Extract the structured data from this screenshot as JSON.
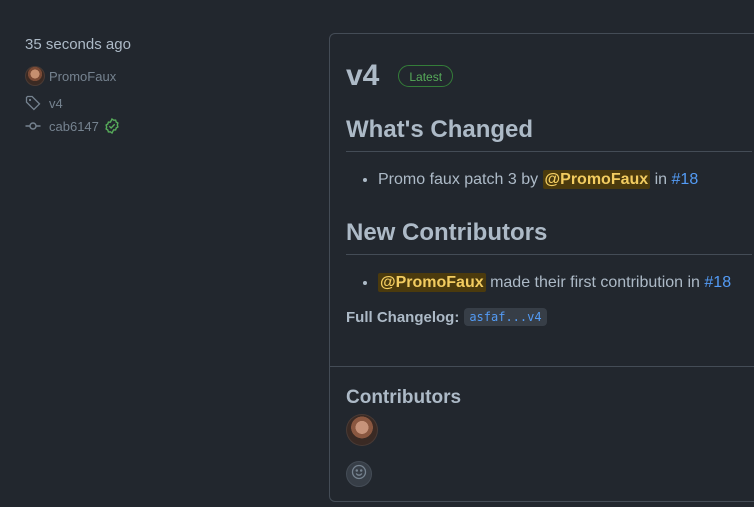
{
  "meta": {
    "time": "35 seconds ago",
    "author": "PromoFaux",
    "tag": "v4",
    "commit": "cab6147"
  },
  "release": {
    "version": "v4",
    "badge": "Latest",
    "whats_changed_heading": "What's Changed",
    "change_item": {
      "text_before": "Promo faux patch 3 by",
      "mention": "@PromoFaux",
      "in": "in",
      "pr": "#18"
    },
    "new_contributors_heading": "New Contributors",
    "contributor_item": {
      "mention": "@PromoFaux",
      "text": "made their first contribution in",
      "pr": "#18"
    },
    "changelog_label": "Full Changelog:",
    "changelog_range": "asfaf...v4"
  },
  "contributors": {
    "title": "Contributors"
  },
  "colors": {
    "background": "#22272e",
    "border": "#444c56",
    "link": "#539bf5",
    "success": "#57ab5a",
    "mention_bg": "#4b3a0d",
    "mention_fg": "#f2cc60"
  }
}
